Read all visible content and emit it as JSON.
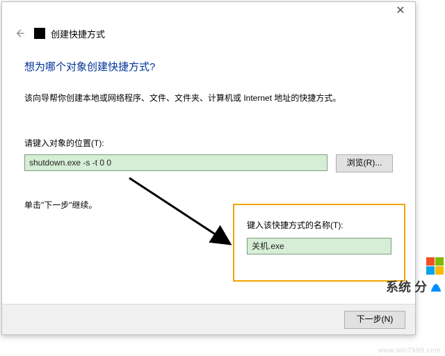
{
  "titlebar": {
    "close_glyph": "✕"
  },
  "header": {
    "wizard_title": "创建快捷方式"
  },
  "question": "想为哪个对象创建快捷方式?",
  "description": "该向导帮你创建本地或网络程序、文件、文件夹、计算机或 Internet 地址的快捷方式。",
  "location": {
    "label": "请键入对象的位置(T):",
    "value": "shutdown.exe -s -t 0 0",
    "browse_label": "浏览(R)..."
  },
  "continue_text": "单击\"下一步\"继续。",
  "callout": {
    "label": "键入该快捷方式的名称(T):",
    "value": "关机.exe"
  },
  "footer": {
    "next_label": "下一步(N)"
  },
  "watermark": {
    "brand": "系统    分",
    "url": "www.win7999.com"
  }
}
